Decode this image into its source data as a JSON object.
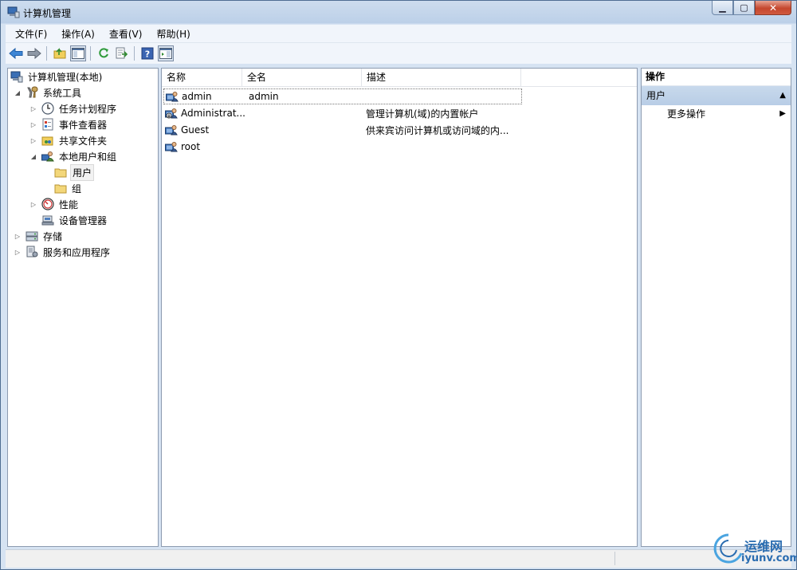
{
  "window": {
    "title": "计算机管理"
  },
  "menu": [
    {
      "label": "文件(F)"
    },
    {
      "label": "操作(A)"
    },
    {
      "label": "查看(V)"
    },
    {
      "label": "帮助(H)"
    }
  ],
  "tree": {
    "root": "计算机管理(本地)",
    "system_tools": "系统工具",
    "task_scheduler": "任务计划程序",
    "event_viewer": "事件查看器",
    "shared_folders": "共享文件夹",
    "local_users_groups": "本地用户和组",
    "users": "用户",
    "groups": "组",
    "performance": "性能",
    "device_manager": "设备管理器",
    "storage": "存储",
    "services_apps": "服务和应用程序"
  },
  "list": {
    "columns": [
      "名称",
      "全名",
      "描述"
    ],
    "rows": [
      {
        "name": "admin",
        "fullname": "admin",
        "description": ""
      },
      {
        "name": "Administrat...",
        "fullname": "",
        "description": "管理计算机(域)的内置帐户"
      },
      {
        "name": "Guest",
        "fullname": "",
        "description": "供来宾访问计算机或访问域的内..."
      },
      {
        "name": "root",
        "fullname": "",
        "description": ""
      }
    ]
  },
  "actions": {
    "header": "操作",
    "section": "用户",
    "more": "更多操作"
  },
  "watermark": {
    "text": "运维网",
    "url": "iyunv.com"
  }
}
